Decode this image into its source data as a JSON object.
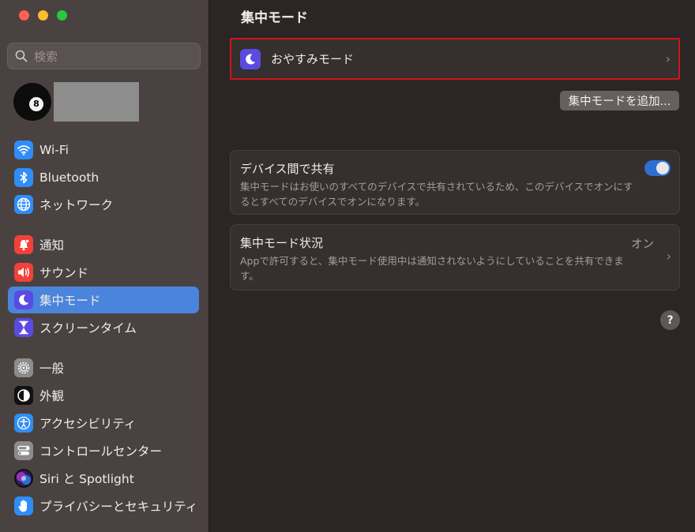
{
  "window": {
    "colors": {
      "close": "#fe5f57",
      "minimize": "#febc2e",
      "zoom": "#28c840"
    }
  },
  "sidebar": {
    "search_placeholder": "検索",
    "items": [
      {
        "label": "Wi-Fi",
        "icon": "wifi-icon",
        "color": "#2f8df6"
      },
      {
        "label": "Bluetooth",
        "icon": "bluetooth-icon",
        "color": "#2f8df6"
      },
      {
        "label": "ネットワーク",
        "icon": "globe-icon",
        "color": "#2f8df6"
      },
      {
        "label": "通知",
        "icon": "bell-icon",
        "color": "#f1413a"
      },
      {
        "label": "サウンド",
        "icon": "speaker-icon",
        "color": "#f1413a"
      },
      {
        "label": "集中モード",
        "icon": "moon-icon",
        "color": "#5a4be0",
        "active": true
      },
      {
        "label": "スクリーンタイム",
        "icon": "hourglass-icon",
        "color": "#5a4be0"
      },
      {
        "label": "一般",
        "icon": "gear-icon",
        "color": "#8c8c8c"
      },
      {
        "label": "外観",
        "icon": "appearance-icon",
        "color": "#111111"
      },
      {
        "label": "アクセシビリティ",
        "icon": "accessibility-icon",
        "color": "#2f8df6"
      },
      {
        "label": "コントロールセンター",
        "icon": "control-center-icon",
        "color": "#8c8c8c"
      },
      {
        "label": "Siri と Spotlight",
        "icon": "siri-icon",
        "color": "#6a3ad8"
      },
      {
        "label": "プライバシーとセキュリティ",
        "icon": "hand-icon",
        "color": "#2f8df6"
      }
    ]
  },
  "main": {
    "title": "集中モード",
    "focus_item": "おやすみモード",
    "add_button": "集中モードを追加...",
    "share": {
      "title": "デバイス間で共有",
      "description": "集中モードはお使いのすべてのデバイスで共有されているため、このデバイスでオンにするとすべてのデバイスでオンになります。",
      "enabled": true
    },
    "status": {
      "title": "集中モード状況",
      "value": "オン",
      "description": "Appで許可すると、集中モード使用中は通知されないようにしていることを共有できます。"
    },
    "help": "?"
  }
}
